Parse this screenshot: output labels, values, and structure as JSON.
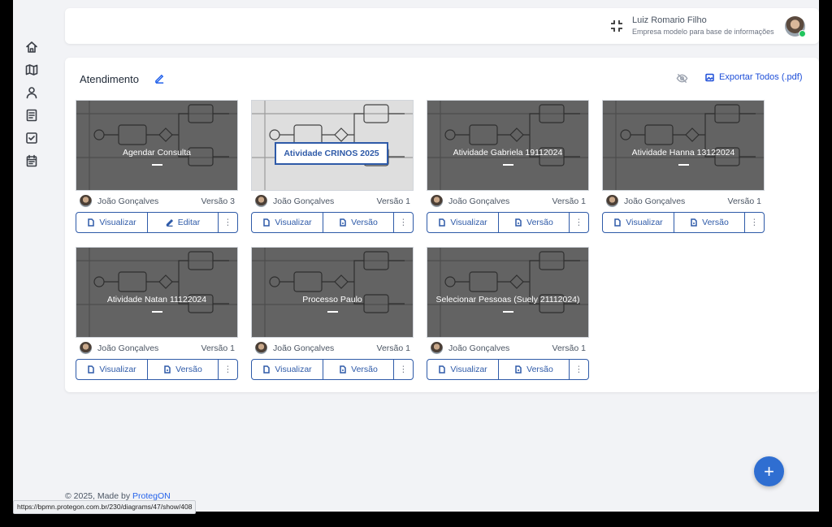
{
  "header": {
    "user_name": "Luiz Romario Filho",
    "company": "Empresa modelo para base de informações"
  },
  "sidebar": {
    "icons": [
      "home-icon",
      "map-icon",
      "user-icon",
      "document-list-icon",
      "checkbox-icon",
      "calendar-icon"
    ]
  },
  "panel": {
    "title": "Atendimento",
    "export_label": "Exportar Todos (.pdf)"
  },
  "cards": [
    {
      "title": "Agendar Consulta",
      "author": "João Gonçalves",
      "version": "Versão 3",
      "btn1": "Visualizar",
      "btn2": "Editar",
      "more": "⋮"
    },
    {
      "title": "Atividade CRINOS 2025",
      "author": "João Gonçalves",
      "version": "Versão 1",
      "btn1": "Visualizar",
      "btn2": "Versão",
      "more": "⋮"
    },
    {
      "title": "Atividade Gabriela 19112024",
      "author": "João Gonçalves",
      "version": "Versão 1",
      "btn1": "Visualizar",
      "btn2": "Versão",
      "more": "⋮"
    },
    {
      "title": "Atividade Hanna 13122024",
      "author": "João Gonçalves",
      "version": "Versão 1",
      "btn1": "Visualizar",
      "btn2": "Versão",
      "more": "⋮"
    },
    {
      "title": "Atividade Natan 11122024",
      "author": "João Gonçalves",
      "version": "Versão 1",
      "btn1": "Visualizar",
      "btn2": "Versão",
      "more": "⋮"
    },
    {
      "title": "Processo Paulo",
      "author": "João Gonçalves",
      "version": "Versão 1",
      "btn1": "Visualizar",
      "btn2": "Versão",
      "more": "⋮"
    },
    {
      "title": "Selecionar Pessoas (Suely 21112024)",
      "author": "João Gonçalves",
      "version": "Versão 1",
      "btn1": "Visualizar",
      "btn2": "Versão",
      "more": "⋮"
    }
  ],
  "footer": {
    "text": "© 2025, Made by ",
    "link": "ProtegON"
  },
  "fab_label": "+",
  "status_url": "https://bpmn.protegon.com.br/230/diagrams/47/show/408",
  "colors": {
    "accent": "#2e5aa8",
    "fab": "#2f6ed1",
    "background": "#f2f3f6"
  }
}
